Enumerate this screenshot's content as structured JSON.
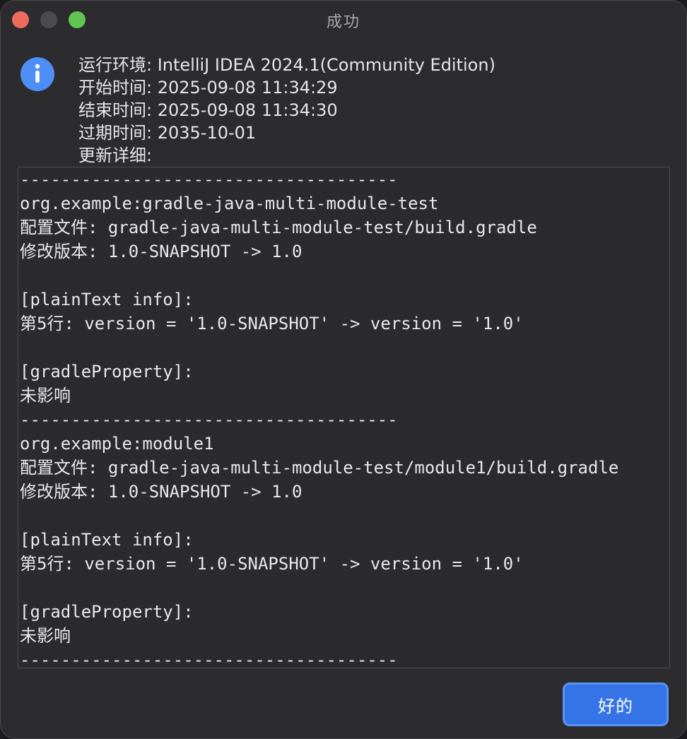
{
  "colors": {
    "close": "#ed6a5e",
    "minimize": "#4b4b4f",
    "zoom": "#61c554",
    "info_icon_bg": "#4f8ef7",
    "button_bg": "#3574e6",
    "button_border": "#5b92f5"
  },
  "window": {
    "title": "成功"
  },
  "icon": {
    "name": "info-icon"
  },
  "summary": {
    "lines": [
      "运行环境: IntelliJ IDEA 2024.1(Community Edition)",
      "开始时间: 2025-09-08 11:34:29",
      "结束时间: 2025-09-08 11:34:30",
      "过期时间: 2035-10-01",
      "更新详细:"
    ]
  },
  "details": {
    "lines": [
      "-------------------------------------",
      "org.example:gradle-java-multi-module-test",
      "配置文件: gradle-java-multi-module-test/build.gradle",
      "修改版本: 1.0-SNAPSHOT -> 1.0",
      "",
      "[plainText info]:",
      "第5行: version = '1.0-SNAPSHOT' -> version = '1.0'",
      "",
      "[gradleProperty]:",
      "未影响",
      "-------------------------------------",
      "org.example:module1",
      "配置文件: gradle-java-multi-module-test/module1/build.gradle",
      "修改版本: 1.0-SNAPSHOT -> 1.0",
      "",
      "[plainText info]:",
      "第5行: version = '1.0-SNAPSHOT' -> version = '1.0'",
      "",
      "[gradleProperty]:",
      "未影响",
      "-------------------------------------"
    ]
  },
  "buttons": {
    "ok_label": "好的"
  }
}
